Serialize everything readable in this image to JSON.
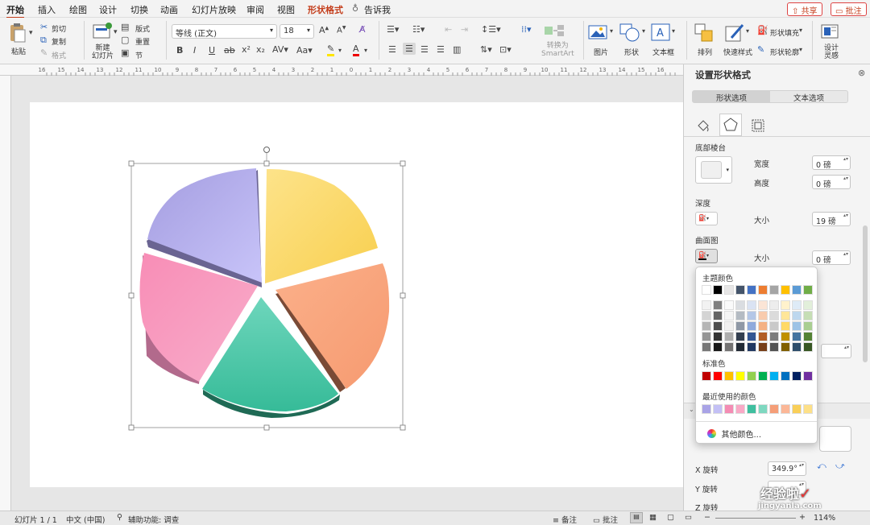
{
  "menu": {
    "items": [
      "开始",
      "插入",
      "绘图",
      "设计",
      "切换",
      "动画",
      "幻灯片放映",
      "审阅",
      "视图"
    ],
    "active_tab": "形状格式",
    "tell_me": "告诉我",
    "share": "共享",
    "comment": "批注"
  },
  "ribbon": {
    "paste": "粘贴",
    "cut": "剪切",
    "copy": "复制",
    "format": "格式",
    "new_slide": "新建\n幻灯片",
    "layout": "版式",
    "reset": "重置",
    "section": "节",
    "font_name": "等线 (正文)",
    "font_size": "18",
    "convert_smartart": "转换为\nSmartArt",
    "picture": "图片",
    "shape": "形状",
    "textbox": "文本框",
    "arrange": "排列",
    "quick_styles": "快速样式",
    "shape_fill": "形状填充",
    "shape_outline": "形状轮廓",
    "design_ideas": "设计\n灵感"
  },
  "ruler": {
    "ticks": [
      "16",
      "15",
      "14",
      "13",
      "12",
      "11",
      "10",
      "9",
      "8",
      "7",
      "6",
      "5",
      "4",
      "3",
      "2",
      "1",
      "0",
      "1",
      "2",
      "3",
      "4",
      "5",
      "6",
      "7",
      "8",
      "9",
      "10",
      "11",
      "12",
      "13",
      "14",
      "15",
      "16"
    ]
  },
  "panel": {
    "title": "设置形状格式",
    "tab_shape": "形状选项",
    "tab_text": "文本选项",
    "bottom_bevel": "底部棱台",
    "width_label": "宽度",
    "width_value": "0 磅",
    "height_label": "高度",
    "height_value": "0 磅",
    "depth": "深度",
    "depth_size_label": "大小",
    "depth_size_value": "19 磅",
    "contour": "曲面图",
    "contour_size_label": "大小",
    "contour_size_value": "0 磅",
    "x_rotation_label": "X 旋转",
    "x_rotation_value": "349.9°",
    "y_rotation_label": "Y 旋转",
    "z_rotation_label": "Z 旋转"
  },
  "picker": {
    "theme_colors": "主题颜色",
    "standard_colors": "标准色",
    "recent_colors": "最近使用的颜色",
    "more_colors": "其他颜色...",
    "theme_top": [
      "#ffffff",
      "#000000",
      "#e7e6e6",
      "#44546a",
      "#4472c4",
      "#ed7d31",
      "#a5a5a5",
      "#ffc000",
      "#5b9bd5",
      "#70ad47"
    ],
    "standard": [
      "#c00000",
      "#ff0000",
      "#ffc000",
      "#ffff00",
      "#92d050",
      "#00b050",
      "#00b0f0",
      "#0070c0",
      "#002060",
      "#7030a0"
    ],
    "recent": [
      "#a9a3e6",
      "#c3c0f5",
      "#f48cb4",
      "#f9a9c6",
      "#3fbf9f",
      "#7ed8c0",
      "#f59e78",
      "#fbb797",
      "#f9cf58",
      "#fde088"
    ]
  },
  "status": {
    "slide": "幻灯片 1 / 1",
    "lang": "中文 (中国)",
    "accessibility": "辅助功能: 调查",
    "notes": "备注",
    "comments": "批注",
    "zoom": "114%"
  },
  "watermark": {
    "cn": "经验啦",
    "url": "jingyanla.com"
  }
}
